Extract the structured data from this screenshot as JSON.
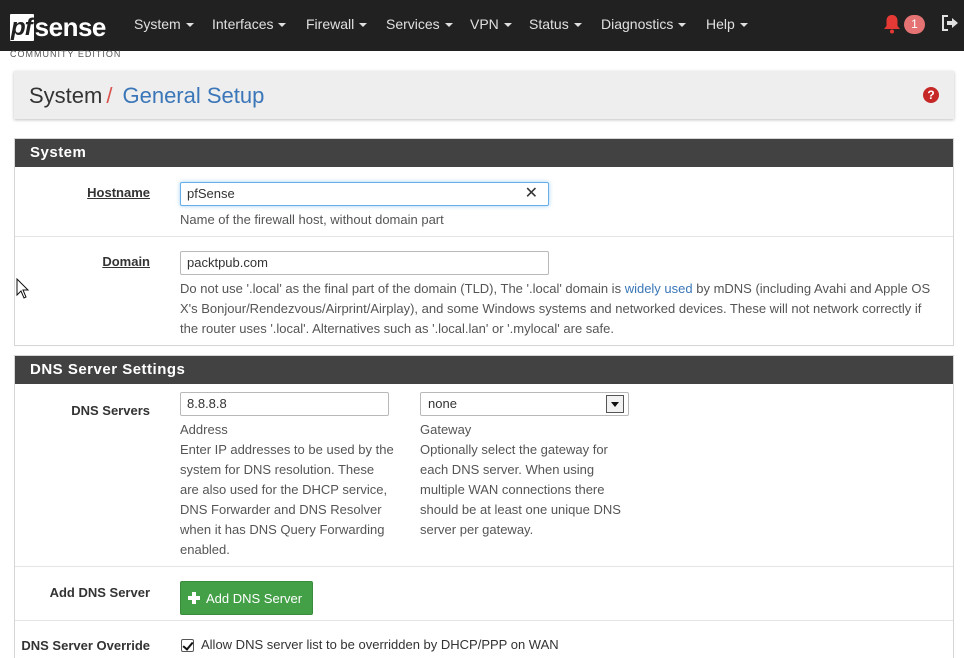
{
  "navbar": {
    "brand_pf": "pf",
    "brand_sense": "sense",
    "edition": "COMMUNITY EDITION",
    "menu": [
      {
        "label": "System"
      },
      {
        "label": "Interfaces"
      },
      {
        "label": "Firewall"
      },
      {
        "label": "Services"
      },
      {
        "label": "VPN"
      },
      {
        "label": "Status"
      },
      {
        "label": "Diagnostics"
      },
      {
        "label": "Help"
      }
    ],
    "notification_count": "1",
    "icons": {
      "notifications": "bell-icon",
      "logout": "sign-out-icon"
    }
  },
  "breadcrumb": {
    "parent": "System",
    "separator": "/",
    "current": "General Setup"
  },
  "help_icon": "?",
  "sections": {
    "system": {
      "title": "System",
      "hostname": {
        "label": "Hostname",
        "value": "pfSense",
        "help": "Name of the firewall host, without domain part"
      },
      "domain": {
        "label": "Domain",
        "value": "packtpub.com",
        "help_1": "Do not use '.local' as the final part of the domain (TLD), The '.local' domain is ",
        "help_link": "widely used",
        "help_2": " by mDNS (including Avahi and Apple OS X's Bonjour/Rendezvous/Airprint/Airplay), and some Windows systems and networked devices. These will not network correctly if the router uses '.local'. Alternatives such as '.local.lan' or '.mylocal' are safe."
      }
    },
    "dns": {
      "title": "DNS Server Settings",
      "servers": {
        "label": "DNS Servers",
        "address_value": "8.8.8.8",
        "address_title": "Address",
        "address_help": "Enter IP addresses to be used by the system for DNS resolution. These are also used for the DHCP service, DNS Forwarder and DNS Resolver when it has DNS Query Forwarding enabled.",
        "gateway_value": "none",
        "gateway_title": "Gateway",
        "gateway_help": "Optionally select the gateway for each DNS server. When using multiple WAN connections there should be at least one unique DNS server per gateway."
      },
      "add": {
        "label": "Add DNS Server",
        "button": "Add DNS Server"
      },
      "override": {
        "label": "DNS Server Override",
        "checked": true,
        "checkbox_label": "Allow DNS server list to be overridden by DHCP/PPP on WAN"
      }
    }
  },
  "colors": {
    "navbar": "#212121",
    "panel_heading": "#424242",
    "link": "#3a76b8",
    "success": "#43a047",
    "danger": "#c62828"
  }
}
